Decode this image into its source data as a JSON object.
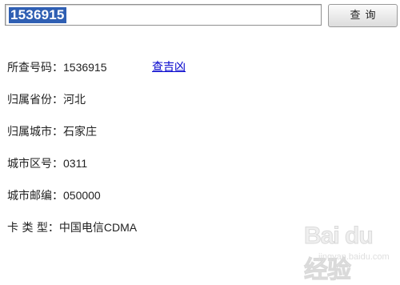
{
  "search": {
    "value": "1536915",
    "button_label": "查询"
  },
  "result": {
    "number_label": "所查号码：",
    "number_value": "1536915",
    "lookup_link": "查吉凶",
    "province_label": "归属省份：",
    "province_value": "河北",
    "city_label": "归属城市：",
    "city_value": "石家庄",
    "area_code_label": "城市区号：",
    "area_code_value": "0311",
    "postcode_label": "城市邮编：",
    "postcode_value": "050000",
    "card_type_label": "卡 类 型：",
    "card_type_value": "中国电信CDMA"
  },
  "watermark": {
    "logo_text": "Bai du 经验",
    "url": "jingyan.baidu.com"
  }
}
